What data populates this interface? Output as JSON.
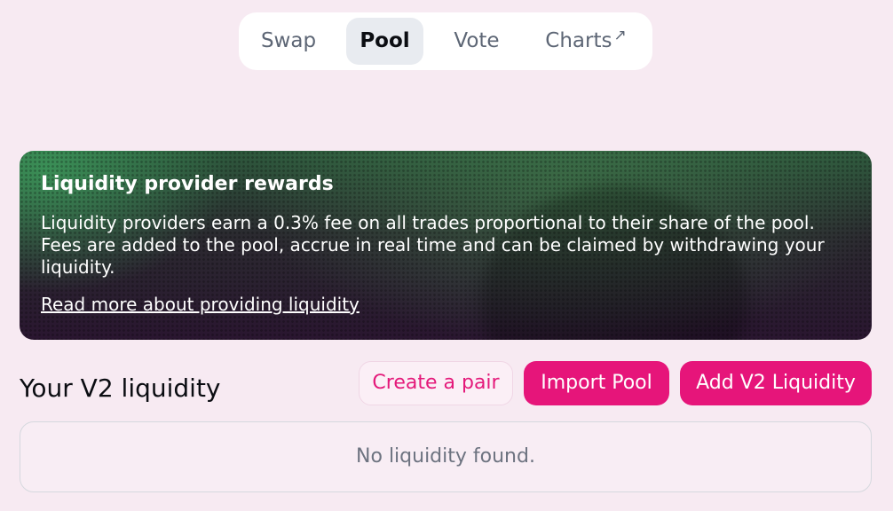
{
  "nav": {
    "items": [
      {
        "label": "Swap",
        "active": false
      },
      {
        "label": "Pool",
        "active": true
      },
      {
        "label": "Vote",
        "active": false
      },
      {
        "label": "Charts",
        "active": false,
        "external_icon": "arrow-up-right-icon"
      }
    ],
    "external_glyph": "↗"
  },
  "banner": {
    "title": "Liquidity provider rewards",
    "text_line1": "Liquidity providers earn a 0.3% fee on all trades proportional to their share of the pool.",
    "text_line2": "Fees are added to the pool, accrue in real time and can be claimed by withdrawing your liquidity.",
    "link_label": "Read more about providing liquidity"
  },
  "liquidity": {
    "title": "Your V2 liquidity",
    "create_pair_label": "Create a pair",
    "import_pool_label": "Import Pool",
    "add_liquidity_label": "Add V2 Liquidity",
    "empty_message": "No liquidity found."
  },
  "colors": {
    "accent": "#e6157a",
    "background": "#f7eaf2",
    "active_tab_bg": "#e8ebf0"
  }
}
